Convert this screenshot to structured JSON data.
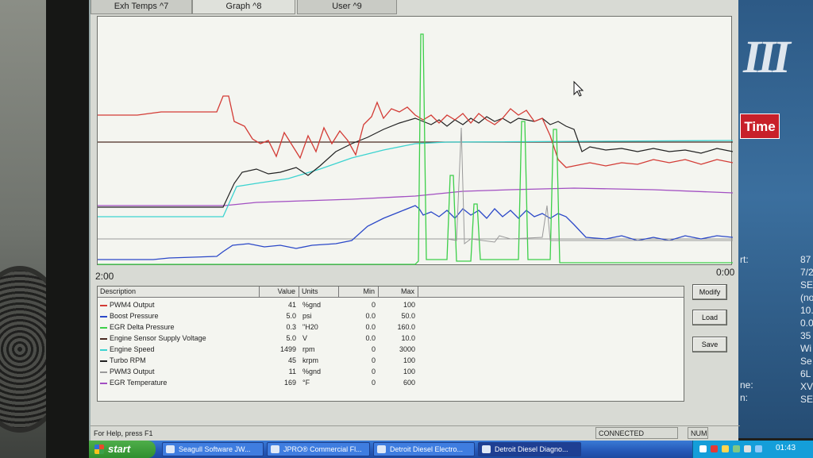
{
  "tabs": [
    {
      "label": "Exh Temps ^7"
    },
    {
      "label": "Graph ^8"
    },
    {
      "label": "User ^9"
    }
  ],
  "graph": {
    "time_start": "2:00",
    "time_end": "0:00"
  },
  "table": {
    "headers": {
      "description": "Description",
      "value": "Value",
      "units": "Units",
      "min": "Min",
      "max": "Max"
    },
    "rows": [
      {
        "description": "PWM4 Output",
        "value": "41",
        "units": "%gnd",
        "min": "0",
        "max": "100",
        "color": "#d33b35"
      },
      {
        "description": "Boost Pressure",
        "value": "5.0",
        "units": "psi",
        "min": "0.0",
        "max": "50.0",
        "color": "#2b48c8"
      },
      {
        "description": "EGR Delta Pressure",
        "value": "0.3",
        "units": "\"H20",
        "min": "0.0",
        "max": "160.0",
        "color": "#3ccf49"
      },
      {
        "description": "Engine Sensor Supply Voltage",
        "value": "5.0",
        "units": "V",
        "min": "0.0",
        "max": "10.0",
        "color": "#4a2a22"
      },
      {
        "description": "Engine Speed",
        "value": "1499",
        "units": "rpm",
        "min": "0",
        "max": "3000",
        "color": "#3cd3d0"
      },
      {
        "description": "Turbo RPM",
        "value": "45",
        "units": "krpm",
        "min": "0",
        "max": "100",
        "color": "#222222"
      },
      {
        "description": "PWM3 Output",
        "value": "11",
        "units": "%gnd",
        "min": "0",
        "max": "100",
        "color": "#9a9a9a"
      },
      {
        "description": "EGR Temperature",
        "value": "169",
        "units": "°F",
        "min": "0",
        "max": "600",
        "color": "#a24fc2"
      }
    ]
  },
  "buttons": {
    "modify": "Modify",
    "load": "Load",
    "save": "Save"
  },
  "status": {
    "help": "For Help, press F1",
    "connection": "CONNECTED",
    "num": "NUM"
  },
  "taskbar": {
    "start": "start",
    "tasks": [
      {
        "label": "Seagull Software JW..."
      },
      {
        "label": "JPRO® Commercial Fl..."
      },
      {
        "label": "Detroit Diesel Electro..."
      },
      {
        "label": "Detroit Diesel Diagno..."
      }
    ],
    "clock": "01:43"
  },
  "background_app": {
    "logo": "III",
    "time_button": "Time",
    "labels": [
      "rt:",
      "ne:",
      "n:"
    ],
    "values": [
      "87",
      "7/2",
      "SE",
      "(no",
      "10.",
      "0.0",
      "35",
      "Wi",
      "Se",
      "6L",
      "XV",
      "SE"
    ]
  }
}
